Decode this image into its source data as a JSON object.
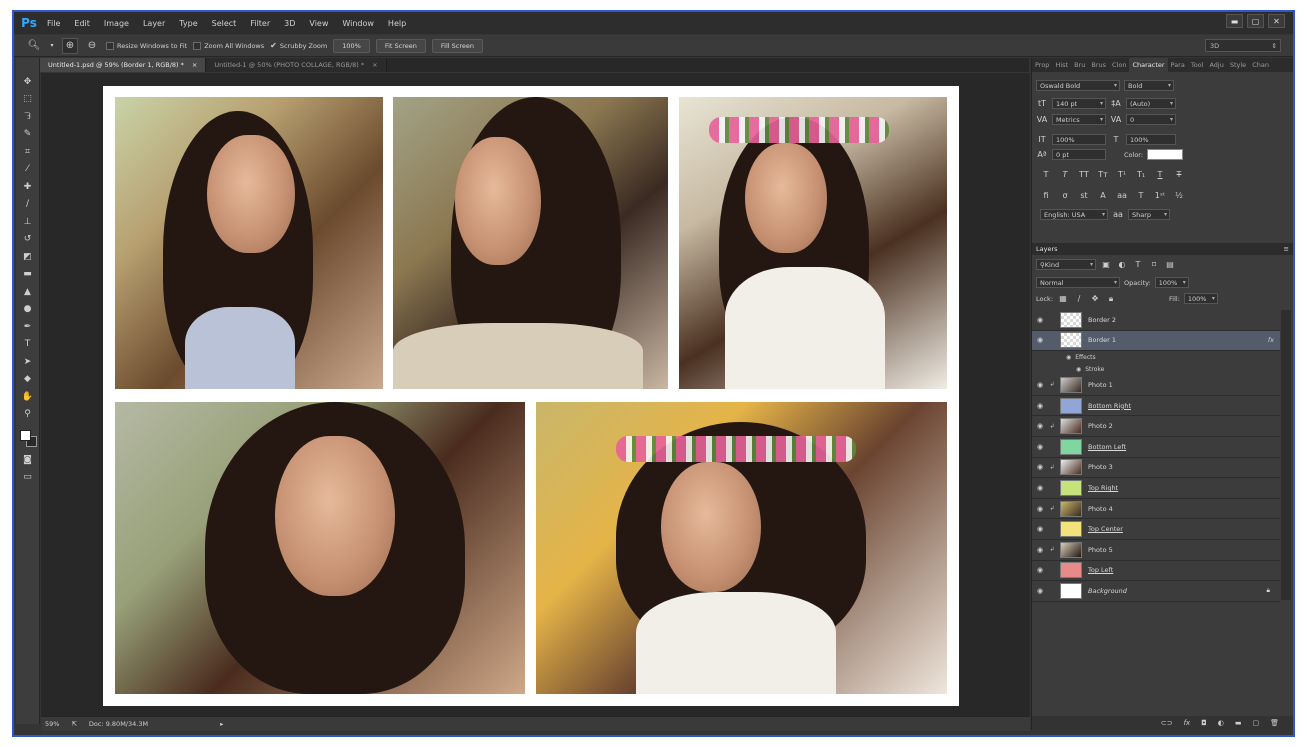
{
  "app": {
    "logo": "Ps"
  },
  "menu": [
    "File",
    "Edit",
    "Image",
    "Layer",
    "Type",
    "Select",
    "Filter",
    "3D",
    "View",
    "Window",
    "Help"
  ],
  "window_controls": [
    "▬",
    "▢",
    "✕"
  ],
  "options": {
    "resize_windows": "Resize Windows to Fit",
    "zoom_all": "Zoom All Windows",
    "scrubby": "Scrubby Zoom",
    "zoom_level": "100%",
    "fit_screen": "Fit Screen",
    "fill_screen": "Fill Screen",
    "workspace": "3D"
  },
  "tabs": [
    {
      "label": "Untitled-1.psd @ 59% (Border 1, RGB/8) *",
      "close": "×"
    },
    {
      "label": "Untitled-1 @ 50% (PHOTO COLLAGE, RGB/8) *",
      "close": "×"
    }
  ],
  "status": {
    "zoom": "59%",
    "doc": "Doc: 9.80M/34.3M"
  },
  "panel_tabs": [
    "Prop",
    "Hist",
    "Bru",
    "Brus",
    "Clon",
    "Character",
    "Para",
    "Tool",
    "Adju",
    "Style",
    "Chan"
  ],
  "character": {
    "font": "Oswald Bold",
    "style": "Bold",
    "size": "140 pt",
    "leading": "(Auto)",
    "kerning": "Metrics",
    "tracking": "0",
    "v_scale": "100%",
    "h_scale": "100%",
    "baseline": "0 pt",
    "color_label": "Color:",
    "language": "English: USA",
    "aa_icon": "aa",
    "antialias": "Sharp"
  },
  "layers_panel": {
    "title": "Layers",
    "filter": "Kind",
    "blend": "Normal",
    "opacity_label": "Opacity:",
    "opacity": "100%",
    "lock_label": "Lock:",
    "fill_label": "Fill:",
    "fill": "100%",
    "effects": "Effects",
    "stroke": "Stroke",
    "fx": "fx",
    "layers": [
      {
        "name": "Border 2"
      },
      {
        "name": "Border 1"
      },
      {
        "name": "Photo 1"
      },
      {
        "name": "Bottom Right"
      },
      {
        "name": "Photo 2"
      },
      {
        "name": "Bottom Left"
      },
      {
        "name": "Photo 3"
      },
      {
        "name": "Top Right"
      },
      {
        "name": "Photo 4"
      },
      {
        "name": "Top Center"
      },
      {
        "name": "Photo 5"
      },
      {
        "name": "Top Left"
      },
      {
        "name": "Background"
      }
    ]
  }
}
